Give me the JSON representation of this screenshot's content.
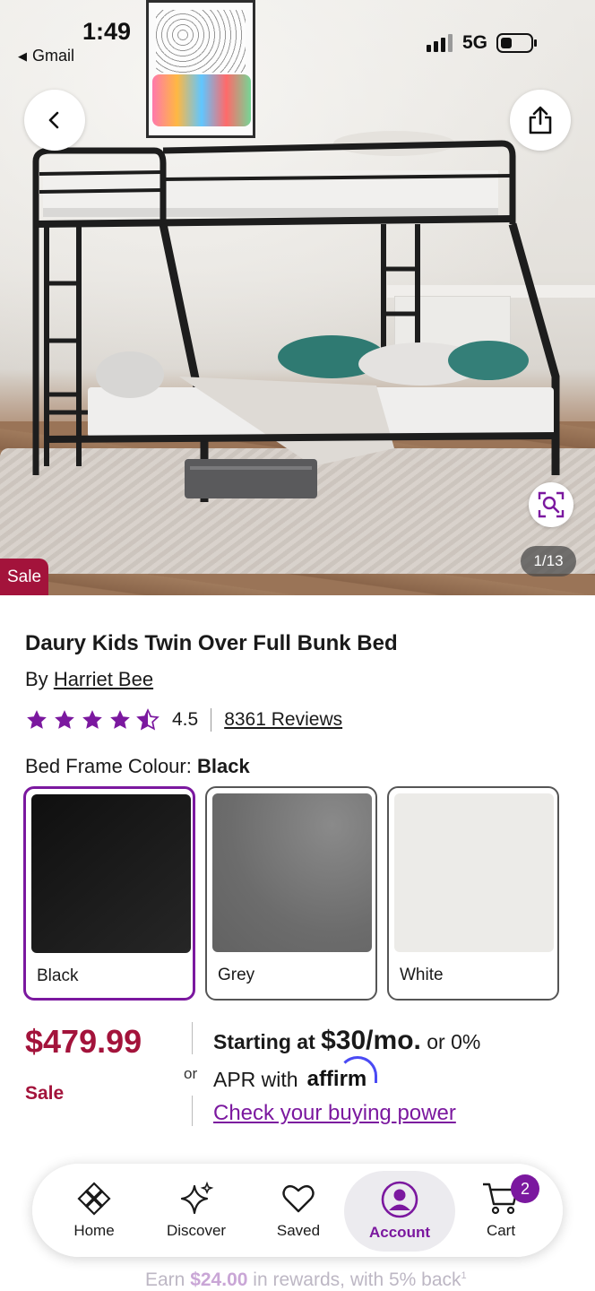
{
  "status_bar": {
    "time": "1:49",
    "back_app": "Gmail",
    "network": "5G"
  },
  "gallery": {
    "counter": "1/13",
    "sale_tag": "Sale",
    "icons": {
      "back": "chevron-left-icon",
      "share": "share-icon",
      "zoom": "visual-search-icon"
    }
  },
  "product": {
    "title": "Daury Kids Twin Over Full Bunk Bed",
    "by_prefix": "By",
    "brand": "Harriet Bee",
    "rating": "4.5",
    "rating_value": 4.5,
    "reviews": "8361 Reviews"
  },
  "options": {
    "label": "Bed Frame Colour:",
    "selected": "Black",
    "swatches": [
      {
        "name": "Black",
        "color": "#1a1a1a",
        "selected": true
      },
      {
        "name": "Grey",
        "color": "#707070",
        "selected": false
      },
      {
        "name": "White",
        "color": "#ecebe8",
        "selected": false
      }
    ]
  },
  "pricing": {
    "price": "$479.99",
    "sale_label": "Sale",
    "or": "or",
    "financing_prefix": "Starting at",
    "monthly": "$30/mo.",
    "financing_suffix": "or 0%",
    "apr_text": "APR with",
    "affirm": "affirm",
    "buying_power": "Check your buying power"
  },
  "rewards": {
    "prefix": "Earn",
    "amount": "$24.00",
    "suffix": "in rewards, with 5% back"
  },
  "nav": {
    "items": [
      {
        "label": "Home",
        "icon": "home-icon",
        "active": false
      },
      {
        "label": "Discover",
        "icon": "sparkle-icon",
        "active": false
      },
      {
        "label": "Saved",
        "icon": "heart-icon",
        "active": false
      },
      {
        "label": "Account",
        "icon": "account-icon",
        "active": true
      },
      {
        "label": "Cart",
        "icon": "cart-icon",
        "active": false,
        "badge": "2"
      }
    ]
  },
  "colors": {
    "brand_purple": "#7b189f",
    "sale_red": "#a3133b"
  }
}
